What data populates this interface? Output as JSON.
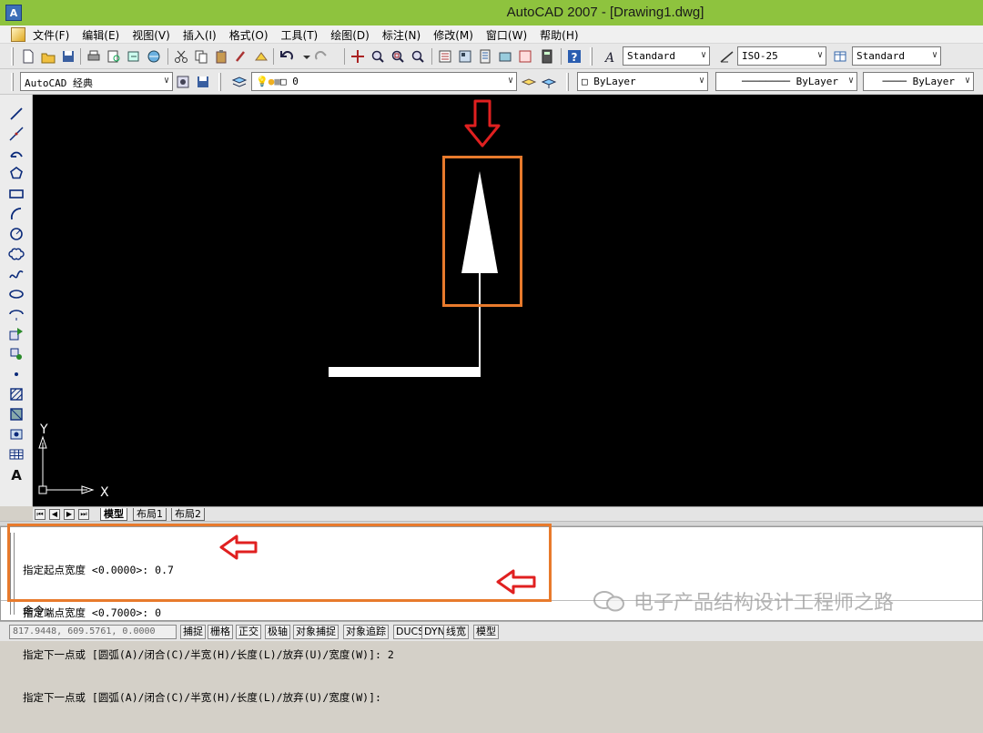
{
  "window": {
    "title": "AutoCAD 2007 - [Drawing1.dwg]",
    "app_icon_letter": "A"
  },
  "menu": {
    "items": [
      "文件(F)",
      "编辑(E)",
      "视图(V)",
      "插入(I)",
      "格式(O)",
      "工具(T)",
      "绘图(D)",
      "标注(N)",
      "修改(M)",
      "窗口(W)",
      "帮助(H)"
    ]
  },
  "toolbar": {
    "text_style": "Standard",
    "dim_style": "ISO-25",
    "table_style": "Standard",
    "workspace": "AutoCAD 经典",
    "layer": "0",
    "color": "ByLayer",
    "linetype": "ByLayer",
    "lineweight": "ByLayer"
  },
  "ucs": {
    "x_label": "X",
    "y_label": "Y"
  },
  "layout_tabs": [
    "模型",
    "布局1",
    "布局2"
  ],
  "command": {
    "lines": [
      "指定起点宽度 <0.0000>: 0.7",
      "指定端点宽度 <0.7000>: 0",
      "指定下一点或 [圆弧(A)/闭合(C)/半宽(H)/长度(L)/放弃(U)/宽度(W)]: 2",
      "指定下一点或 [圆弧(A)/闭合(C)/半宽(H)/长度(L)/放弃(U)/宽度(W)]:"
    ],
    "prompt": "命令:"
  },
  "status": {
    "coords": "817.9448, 609.5761, 0.0000",
    "buttons": [
      "捕捉",
      "栅格",
      "正交",
      "极轴",
      "对象捕捉",
      "对象追踪",
      "DUCS",
      "DYN",
      "线宽",
      "模型"
    ]
  },
  "watermark": {
    "text": "电子产品结构设计工程师之路"
  },
  "colors": {
    "title_bar": "#8ec33e",
    "canvas": "#000000",
    "highlight": "#e87a2c",
    "annotation_arrow": "#e02020"
  }
}
